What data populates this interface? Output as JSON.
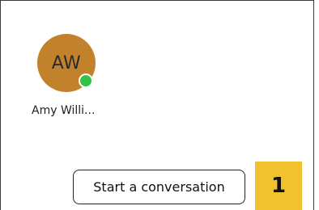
{
  "contact": {
    "initials": "AW",
    "name": "Amy Willi...",
    "presence_status": "available",
    "avatar_color": "#c2812b",
    "presence_color": "#33c24a"
  },
  "actions": {
    "start_conversation_label": "Start a conversation"
  },
  "callout": {
    "number": "1",
    "color": "#f2c12e"
  }
}
